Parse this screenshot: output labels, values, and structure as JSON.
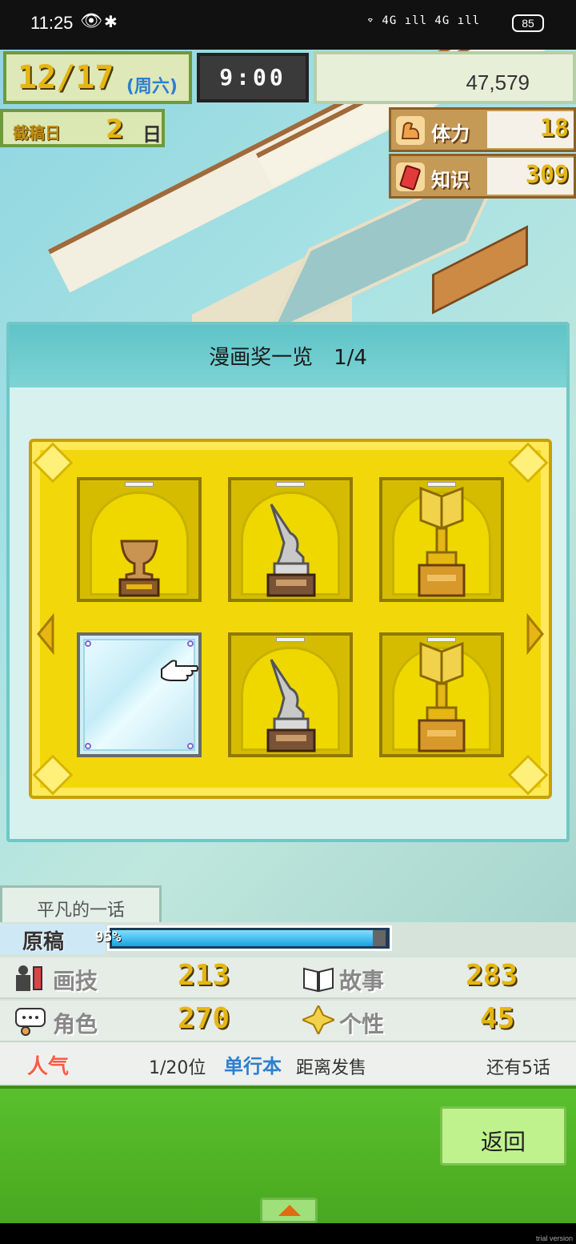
{
  "status_bar": {
    "time": "11:25",
    "eye_icon": "👁",
    "bluetooth_icon": "✱",
    "signal_text": "⌔ 4G ıll 4G ıll",
    "battery": "85"
  },
  "hud": {
    "date": "12/17",
    "weekday": "(周六)",
    "clock": "9:00",
    "money": "47,579",
    "deadline_label": "截稿日",
    "deadline_days": "2",
    "deadline_unit": "日",
    "stamina_label": "体力",
    "stamina_value": "18",
    "knowledge_label": "知识",
    "knowledge_value": "309"
  },
  "dialog": {
    "title": "漫画奖一览　1/4"
  },
  "awards": [
    {
      "type": "bronze-cup"
    },
    {
      "type": "silver-pen"
    },
    {
      "type": "gold-book"
    },
    {
      "type": "empty"
    },
    {
      "type": "silver-pen"
    },
    {
      "type": "gold-book"
    }
  ],
  "manga": {
    "title": "平凡的一话",
    "progress_label": "原稿",
    "progress_text": "95%",
    "progress_fraction": 0.95,
    "stats": [
      {
        "label": "画技",
        "value": "213"
      },
      {
        "label": "故事",
        "value": "283"
      },
      {
        "label": "角色",
        "value": "270"
      },
      {
        "label": "个性",
        "value": "45"
      }
    ],
    "popularity_label": "人气",
    "rank": "1/20位",
    "tankobon_label": "单行本",
    "release_label": "距离发售",
    "remaining": "还有5话"
  },
  "buttons": {
    "back": "返回"
  },
  "watermark": "trial version",
  "colors": {
    "accent_gold": "#e6b614",
    "frame_yellow": "#f2d80a",
    "bottom_green": "#59c02c",
    "dialog_teal": "#5fc4c8"
  }
}
